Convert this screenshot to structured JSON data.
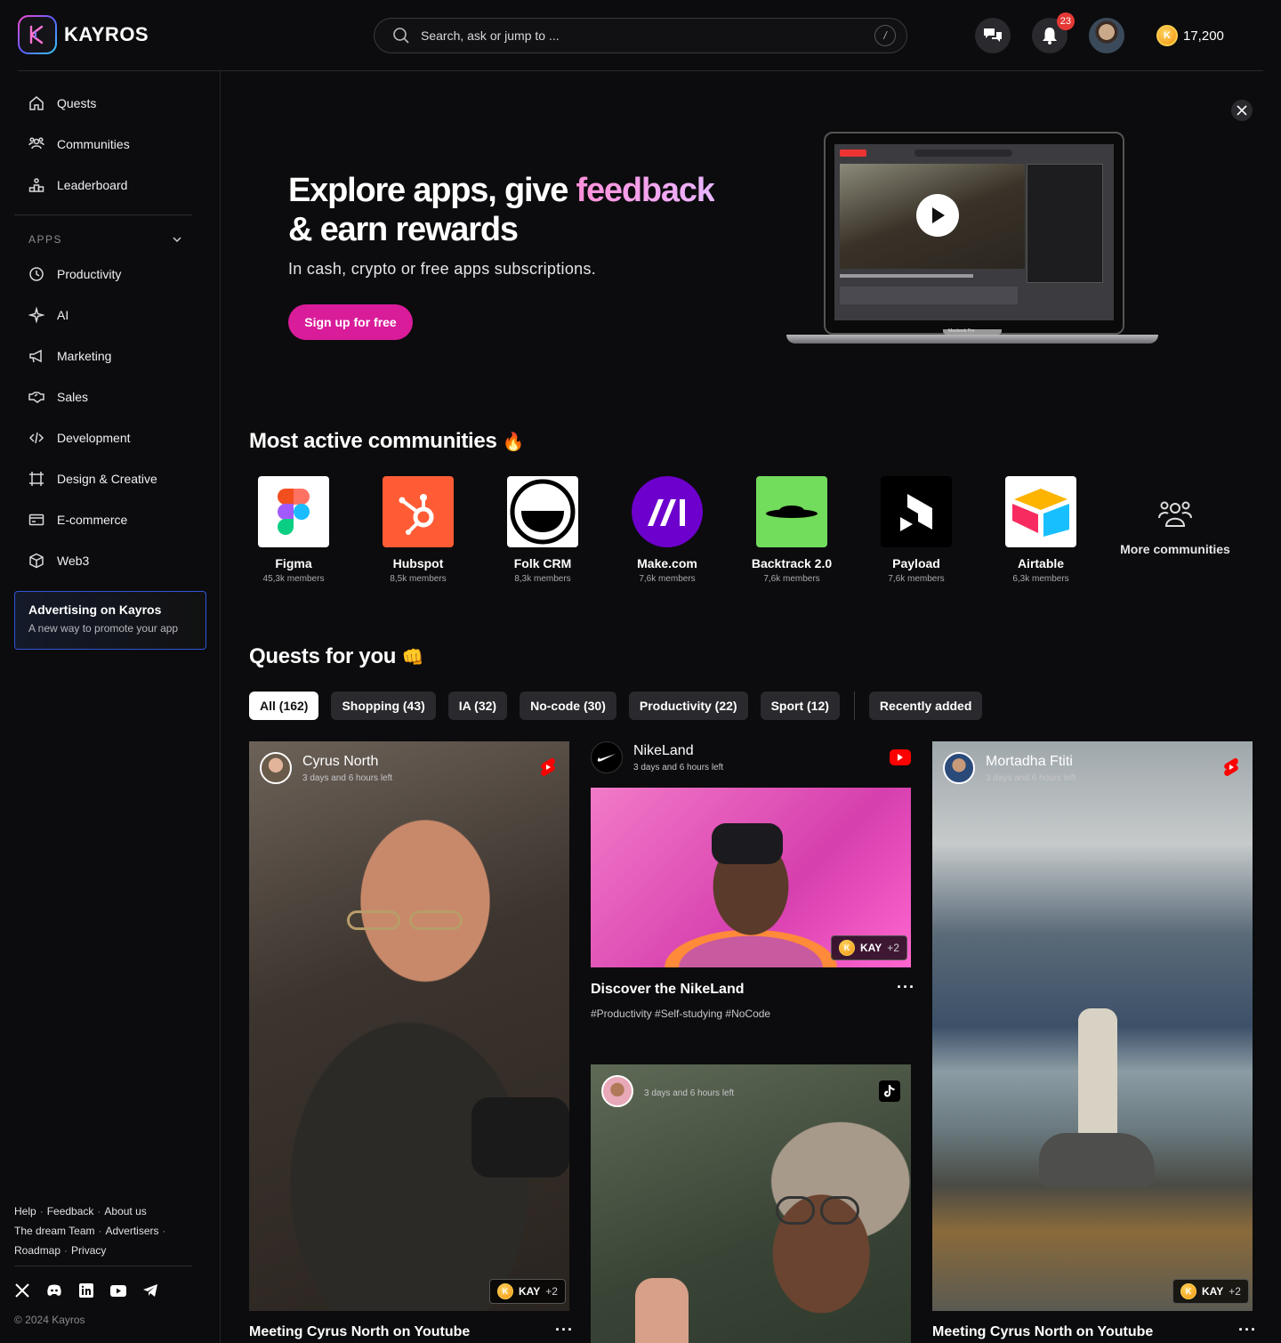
{
  "brand": {
    "name": "KAYROS"
  },
  "search": {
    "placeholder": "Search, ask or jump to ...",
    "shortcut": "/"
  },
  "topbar": {
    "notifications_count": "23",
    "coin_balance": "17,200",
    "coin_letter": "K"
  },
  "sidebar": {
    "main_items": [
      {
        "label": "Quests",
        "icon": "home-icon"
      },
      {
        "label": "Communities",
        "icon": "people-icon"
      },
      {
        "label": "Leaderboard",
        "icon": "leaderboard-icon"
      }
    ],
    "apps_header": "APPS",
    "app_items": [
      {
        "label": "Productivity",
        "icon": "clock-icon"
      },
      {
        "label": "AI",
        "icon": "sparkle-icon"
      },
      {
        "label": "Marketing",
        "icon": "megaphone-icon"
      },
      {
        "label": "Sales",
        "icon": "handshake-icon"
      },
      {
        "label": "Development",
        "icon": "code-icon"
      },
      {
        "label": "Design & Creative",
        "icon": "frame-icon"
      },
      {
        "label": "E-commerce",
        "icon": "credit-card-icon"
      },
      {
        "label": "Web3",
        "icon": "cube-icon"
      }
    ],
    "promo": {
      "title": "Advertising on Kayros",
      "subtitle": "A new way to promote your app"
    },
    "footer_links": [
      "Help",
      "Feedback",
      "About us",
      "The dream Team",
      "Advertisers",
      "Roadmap",
      "Privacy"
    ],
    "social": [
      "x-icon",
      "discord-icon",
      "linkedin-icon",
      "youtube-icon",
      "telegram-icon"
    ],
    "copyright": "© 2024 Kayros"
  },
  "hero": {
    "title_part1": "Explore apps, give ",
    "title_accent": "feedback",
    "title_part2": "& earn rewards",
    "subtitle": "In cash, crypto or free apps subscriptions.",
    "cta": "Sign up for free",
    "device_label": "Macbook Pro"
  },
  "communities": {
    "title": "Most active communities",
    "title_emoji": "🔥",
    "items": [
      {
        "name": "Figma",
        "members": "45,3k members"
      },
      {
        "name": "Hubspot",
        "members": "8,5k members"
      },
      {
        "name": "Folk CRM",
        "members": "8,3k members"
      },
      {
        "name": "Make.com",
        "members": "7,6k members"
      },
      {
        "name": "Backtrack 2.0",
        "members": "7,6k members"
      },
      {
        "name": "Payload",
        "members": "7,6k members"
      },
      {
        "name": "Airtable",
        "members": "6,3k members"
      }
    ],
    "more_label": "More communities"
  },
  "quests": {
    "title": "Quests for you",
    "title_emoji": "👊",
    "filters": [
      "All (162)",
      "Shopping (43)",
      "IA (32)",
      "No-code (30)",
      "Productivity (22)",
      "Sport (12)"
    ],
    "sort_label": "Recently added",
    "cards": [
      {
        "author": "Cyrus North",
        "time": "3 days and 6 hours left",
        "reward": "KAY",
        "reward_plus": "+2",
        "title": "Meeting Cyrus North on Youtube",
        "platform": "youtube-shorts"
      },
      {
        "author": "NikeLand",
        "time": "3 days and 6 hours left",
        "reward": "KAY",
        "reward_plus": "+2",
        "title": "Discover the NikeLand",
        "tags": "#Productivity #Self-studying #NoCode",
        "platform": "youtube"
      },
      {
        "author": "",
        "time": "3 days and 6 hours left",
        "platform": "tiktok"
      },
      {
        "author": "Mortadha Ftiti",
        "time": "3 days and 6 hours left",
        "reward": "KAY",
        "reward_plus": "+2",
        "title": "Meeting Cyrus North on Youtube",
        "platform": "youtube-shorts"
      }
    ]
  },
  "colors": {
    "accent": "#d91c9a",
    "background": "#0c0c0e",
    "promo_border": "#2f56d6",
    "coin": "#f5a623"
  }
}
